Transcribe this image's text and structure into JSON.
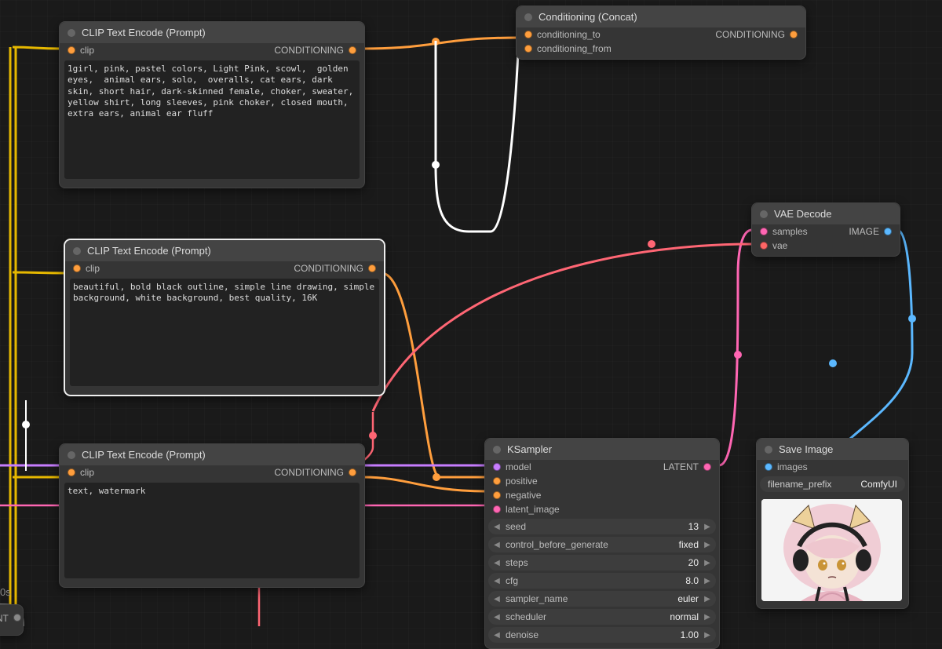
{
  "nodes": {
    "clip1": {
      "title": "CLIP Text Encode (Prompt)",
      "input_label": "clip",
      "output_label": "CONDITIONING",
      "text": "1girl, pink, pastel colors, Light Pink, scowl,  golden eyes,  animal ears, solo,  overalls, cat ears, dark skin, short hair, dark-skinned female, choker, sweater, yellow shirt, long sleeves, pink choker, closed mouth, extra ears, animal ear fluff"
    },
    "clip2": {
      "title": "CLIP Text Encode (Prompt)",
      "input_label": "clip",
      "output_label": "CONDITIONING",
      "text": "beautiful, bold black outline, simple line drawing, simple background, white background, best quality, 16K"
    },
    "clip3": {
      "title": "CLIP Text Encode (Prompt)",
      "input_label": "clip",
      "output_label": "CONDITIONING",
      "text": "text, watermark"
    },
    "concat": {
      "title": "Conditioning (Concat)",
      "in1": "conditioning_to",
      "in2": "conditioning_from",
      "out": "CONDITIONING"
    },
    "vae": {
      "title": "VAE Decode",
      "in1": "samples",
      "in2": "vae",
      "out": "IMAGE"
    },
    "ksampler": {
      "title": "KSampler",
      "inputs": {
        "model": "model",
        "positive": "positive",
        "negative": "negative",
        "latent_image": "latent_image"
      },
      "out": "LATENT",
      "widgets": {
        "seed": {
          "label": "seed",
          "value": "13"
        },
        "control": {
          "label": "control_before_generate",
          "value": "fixed"
        },
        "steps": {
          "label": "steps",
          "value": "20"
        },
        "cfg": {
          "label": "cfg",
          "value": "8.0"
        },
        "sampler": {
          "label": "sampler_name",
          "value": "euler"
        },
        "scheduler": {
          "label": "scheduler",
          "value": "normal"
        },
        "denoise": {
          "label": "denoise",
          "value": "1.00"
        }
      }
    },
    "save": {
      "title": "Save Image",
      "in1": "images",
      "widget": {
        "label": "filename_prefix",
        "value": "ComfyUI"
      }
    },
    "cut1": {
      "out": "NT"
    },
    "cut2": {
      "label": "0s"
    }
  },
  "arrows": {
    "left": "◀",
    "right": "▶"
  }
}
